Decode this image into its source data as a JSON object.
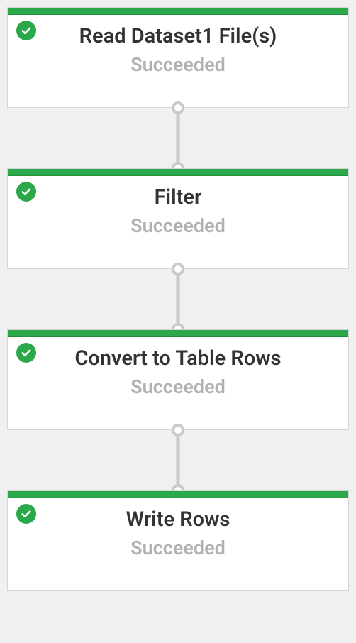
{
  "colors": {
    "success": "#2ba84a",
    "statusText": "#b1b1b1",
    "titleText": "#333333",
    "border": "#d5d5d5",
    "connector": "#c9c9c9"
  },
  "nodes": [
    {
      "title": "Read Dataset1 File(s)",
      "status": "Succeeded",
      "icon": "check-circle-icon"
    },
    {
      "title": "Filter",
      "status": "Succeeded",
      "icon": "check-circle-icon"
    },
    {
      "title": "Convert to Table Rows",
      "status": "Succeeded",
      "icon": "check-circle-icon"
    },
    {
      "title": "Write Rows",
      "status": "Succeeded",
      "icon": "check-circle-icon"
    }
  ]
}
